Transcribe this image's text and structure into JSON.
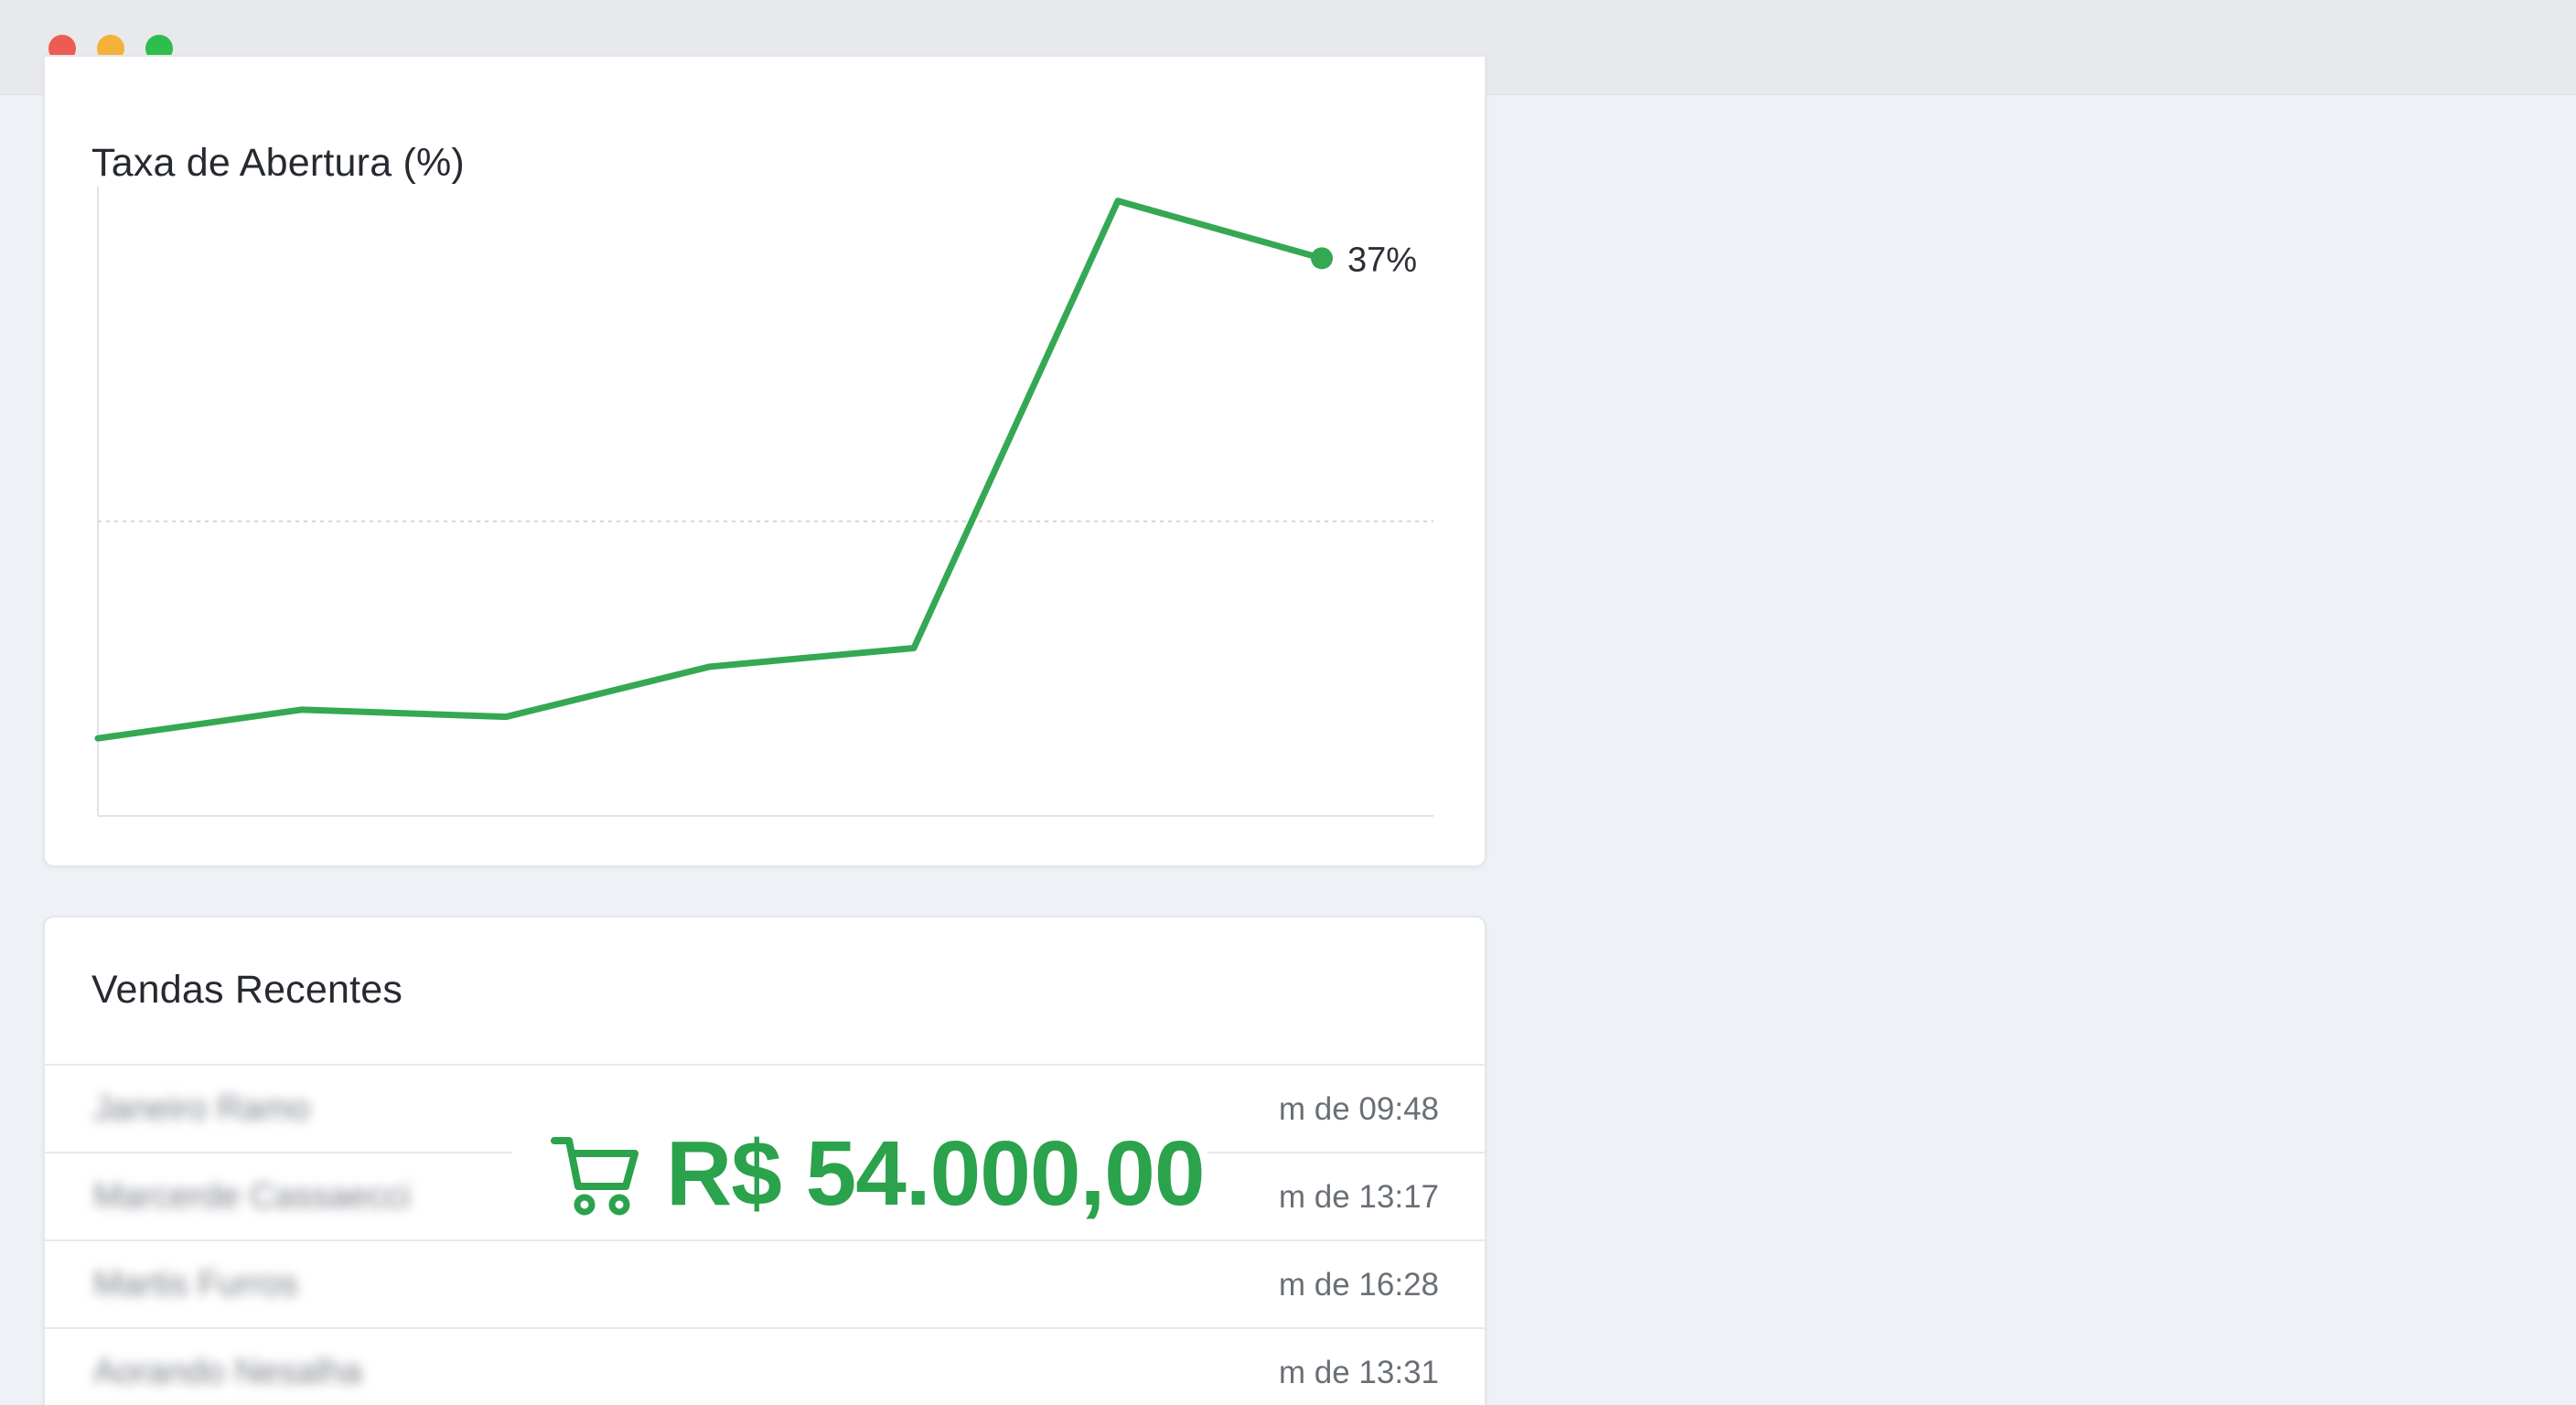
{
  "window": {
    "controls": [
      "close",
      "minimize",
      "zoom"
    ]
  },
  "chart_card": {
    "title": "Taxa de Abertura (%)"
  },
  "chart_data": {
    "type": "line",
    "title": "Taxa de Abertura (%)",
    "x": [
      1,
      2,
      3,
      4,
      5,
      6,
      7
    ],
    "series": [
      {
        "values": [
          3.5,
          5.5,
          5.0,
          8.5,
          9.8,
          41.0,
          37.0
        ],
        "color": "#35a853"
      }
    ],
    "ylim": [
      0,
      42
    ],
    "last_point_label": "37%",
    "grid": "single dotted horizontal line",
    "legend": "none"
  },
  "sales_card": {
    "title": "Vendas Recentes",
    "rows": [
      {
        "name": "Janeiro Ramo",
        "time": "m de 09:48"
      },
      {
        "name": "Marcerde Cassaecci",
        "time": "m de 13:17"
      },
      {
        "name": "Martis Furros",
        "time": "m de 16:28"
      },
      {
        "name": "Aorando Nesalha",
        "time": "m de 13:31"
      }
    ]
  },
  "overlay": {
    "icon": "shopping-cart-icon",
    "amount": "R$ 54.000,00",
    "color": "#2ba24c"
  }
}
